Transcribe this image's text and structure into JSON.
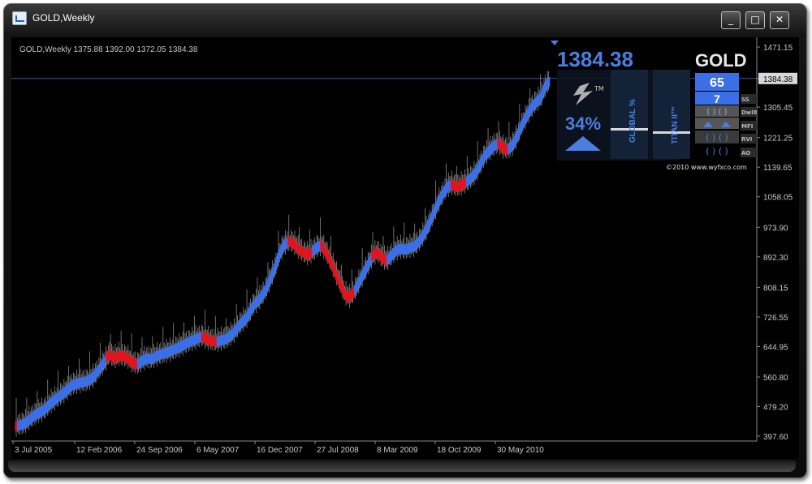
{
  "window": {
    "title": "GOLD,Weekly",
    "buttons": {
      "minimize": "_",
      "maximize": "□",
      "close": "✕"
    }
  },
  "colors": {
    "background": "#000000",
    "up": "#3a6fe8",
    "down": "#e0151f",
    "wick": "#888888",
    "axis_text": "#c8c8c8",
    "accent_blue": "#4b7ee0",
    "price_line": "#3c55b4"
  },
  "chart_data": {
    "type": "line",
    "header": "GOLD,Weekly  1375.88 1392.00 1372.05 1384.38",
    "current_price": 1384.38,
    "x_ticks": [
      "3 Jul 2005",
      "12 Feb 2006",
      "24 Sep 2006",
      "6 May 2007",
      "16 Dec 2007",
      "27 Jul 2008",
      "8 Mar 2009",
      "18 Oct 2009",
      "30 May 2010"
    ],
    "y_ticks": [
      1471.15,
      1384.38,
      1305.45,
      1221.25,
      1139.65,
      1058.05,
      973.9,
      892.3,
      808.15,
      726.55,
      644.95,
      560.8,
      479.2,
      397.6
    ],
    "ylim": [
      397.6,
      1471.15
    ],
    "series": [
      {
        "points": [
          [
            0,
            425
          ],
          [
            6,
            430
          ],
          [
            12,
            445
          ],
          [
            18,
            460
          ],
          [
            24,
            470
          ],
          [
            30,
            490
          ],
          [
            36,
            505
          ],
          [
            42,
            520
          ],
          [
            48,
            538
          ],
          [
            54,
            545
          ],
          [
            60,
            548
          ],
          [
            66,
            560
          ],
          [
            72,
            585
          ],
          [
            78,
            612
          ],
          [
            80,
            625
          ],
          [
            84,
            612
          ],
          [
            88,
            620
          ],
          [
            92,
            618
          ],
          [
            96,
            612
          ],
          [
            100,
            600
          ],
          [
            104,
            595
          ],
          [
            108,
            605
          ],
          [
            112,
            612
          ],
          [
            116,
            610
          ],
          [
            120,
            618
          ],
          [
            126,
            625
          ],
          [
            132,
            632
          ],
          [
            138,
            640
          ],
          [
            144,
            650
          ],
          [
            150,
            660
          ],
          [
            156,
            668
          ],
          [
            160,
            672
          ],
          [
            164,
            665
          ],
          [
            168,
            660
          ],
          [
            172,
            658
          ],
          [
            176,
            662
          ],
          [
            180,
            665
          ],
          [
            186,
            680
          ],
          [
            192,
            705
          ],
          [
            198,
            725
          ],
          [
            204,
            760
          ],
          [
            210,
            780
          ],
          [
            214,
            800
          ],
          [
            218,
            830
          ],
          [
            222,
            860
          ],
          [
            226,
            900
          ],
          [
            230,
            925
          ],
          [
            234,
            935
          ],
          [
            238,
            930
          ],
          [
            242,
            915
          ],
          [
            246,
            905
          ],
          [
            250,
            898
          ],
          [
            254,
            905
          ],
          [
            258,
            918
          ],
          [
            262,
            925
          ],
          [
            266,
            905
          ],
          [
            270,
            880
          ],
          [
            274,
            850
          ],
          [
            278,
            820
          ],
          [
            282,
            790
          ],
          [
            286,
            780
          ],
          [
            290,
            795
          ],
          [
            294,
            820
          ],
          [
            298,
            845
          ],
          [
            302,
            870
          ],
          [
            306,
            895
          ],
          [
            310,
            905
          ],
          [
            314,
            890
          ],
          [
            318,
            882
          ],
          [
            322,
            895
          ],
          [
            326,
            910
          ],
          [
            330,
            915
          ],
          [
            334,
            912
          ],
          [
            338,
            918
          ],
          [
            342,
            922
          ],
          [
            346,
            935
          ],
          [
            350,
            955
          ],
          [
            354,
            980
          ],
          [
            358,
            1010
          ],
          [
            362,
            1040
          ],
          [
            366,
            1065
          ],
          [
            370,
            1085
          ],
          [
            374,
            1092
          ],
          [
            378,
            1085
          ],
          [
            382,
            1090
          ],
          [
            386,
            1098
          ],
          [
            390,
            1108
          ],
          [
            394,
            1122
          ],
          [
            398,
            1145
          ],
          [
            402,
            1170
          ],
          [
            406,
            1185
          ],
          [
            410,
            1198
          ],
          [
            414,
            1205
          ],
          [
            418,
            1192
          ],
          [
            422,
            1188
          ],
          [
            426,
            1200
          ],
          [
            430,
            1225
          ],
          [
            434,
            1255
          ],
          [
            438,
            1280
          ],
          [
            442,
            1302
          ],
          [
            446,
            1318
          ],
          [
            450,
            1330
          ],
          [
            454,
            1360
          ],
          [
            458,
            1380
          ]
        ],
        "x_range": [
          0,
          460
        ]
      }
    ],
    "down_segments": [
      [
        0,
        1
      ],
      [
        78,
        104
      ],
      [
        160,
        172
      ],
      [
        234,
        254
      ],
      [
        262,
        290
      ],
      [
        306,
        318
      ],
      [
        374,
        386
      ],
      [
        414,
        422
      ]
    ],
    "grid": false
  },
  "panel": {
    "price": "1384.38",
    "symbol": "GOLD",
    "percent": "34%",
    "global_label": "GLOBAL %",
    "titan_label": "TITAN II™",
    "tm_mark": "TM",
    "value_a": "65",
    "value_b": "7",
    "braces": "( )  ( )",
    "side_labels": [
      "SS",
      "Dwl8",
      "MFI",
      "RVI",
      "AO"
    ],
    "copyright": "©2010 www.wyfxco.com"
  }
}
